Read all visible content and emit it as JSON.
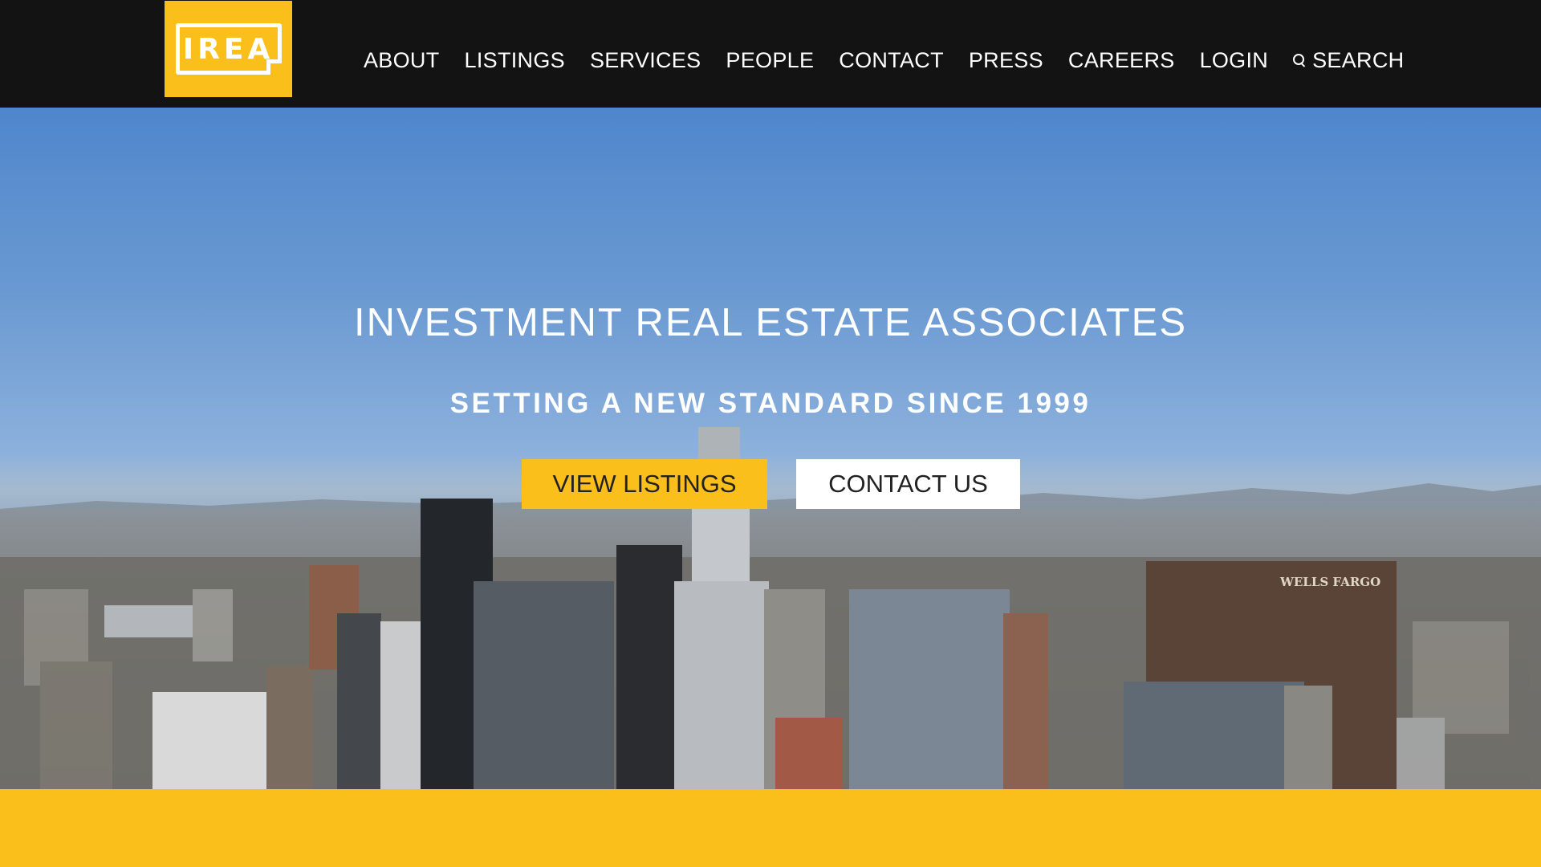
{
  "brand": {
    "logo_text": "IREA",
    "accent_color": "#fbbf1c",
    "header_color": "#131313"
  },
  "nav": {
    "items": [
      {
        "label": "ABOUT"
      },
      {
        "label": "LISTINGS"
      },
      {
        "label": "SERVICES"
      },
      {
        "label": "PEOPLE"
      },
      {
        "label": "CONTACT"
      },
      {
        "label": "PRESS"
      },
      {
        "label": "CAREERS"
      },
      {
        "label": "LOGIN"
      }
    ],
    "search_label": "SEARCH",
    "search_icon": "search-icon"
  },
  "hero": {
    "title": "INVESTMENT REAL ESTATE ASSOCIATES",
    "subtitle": "SETTING A NEW STANDARD SINCE 1999",
    "primary_button": "VIEW LISTINGS",
    "secondary_button": "CONTACT US",
    "building_sign": "WELLS FARGO"
  }
}
